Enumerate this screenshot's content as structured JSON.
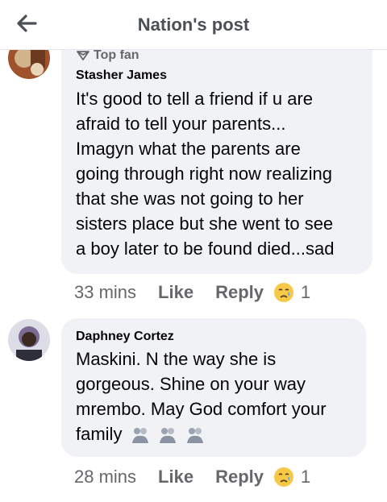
{
  "header": {
    "title": "Nation's post",
    "back_icon": "arrow-left-icon"
  },
  "comments": [
    {
      "badge": "Top fan",
      "author": "Stasher James",
      "lines": [
        "It's good to tell a friend if u are",
        "afraid to tell your parents...",
        "Imagyn what the parents are",
        "going through right now realizing",
        "that she was not going to her",
        "sisters place but she went to see",
        "a boy later to be found died...sad"
      ],
      "time": "33 mins",
      "like": "Like",
      "reply": "Reply",
      "reaction_icon": "crying-face-icon",
      "reaction_count": "1"
    },
    {
      "author": "Daphney Cortez",
      "lines": [
        "Maskini. N the way she is",
        "gorgeous. Shine on your way",
        "mrembo. May God comfort your",
        "family"
      ],
      "trailing_icons": [
        "hugging-people-icon",
        "hugging-people-icon",
        "hugging-people-icon"
      ],
      "time": "28 mins",
      "like": "Like",
      "reply": "Reply",
      "reaction_icon": "crying-face-icon",
      "reaction_count": "1"
    }
  ],
  "colors": {
    "bubble": "#f0f2f5",
    "meta_text": "#65676b",
    "header_text": "#4b4f56"
  }
}
